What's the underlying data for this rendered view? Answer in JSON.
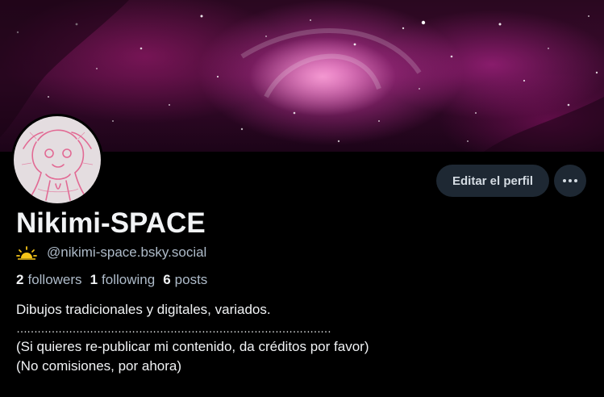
{
  "profile": {
    "display_name": "Nikimi-SPACE",
    "handle": "@nikimi-space.bsky.social",
    "handle_icon": "sun-icon",
    "followers_count": "2",
    "followers_label": "followers",
    "following_count": "1",
    "following_label": "following",
    "posts_count": "6",
    "posts_label": "posts",
    "bio_lines": [
      "Dibujos tradicionales y digitales, variados.",
      "………………………………………………………………………………",
      "(Si quieres re-publicar mi contenido, da créditos por favor)",
      "(No comisiones, por ahora)"
    ]
  },
  "actions": {
    "edit_profile_label": "Editar el perfil",
    "more_icon": "ellipsis-icon"
  },
  "colors": {
    "background": "#000000",
    "button_bg": "#1e2833",
    "muted_text": "#aebbc9",
    "primary_text": "#f1f3f5",
    "banner_accent": "#c83a9a"
  }
}
